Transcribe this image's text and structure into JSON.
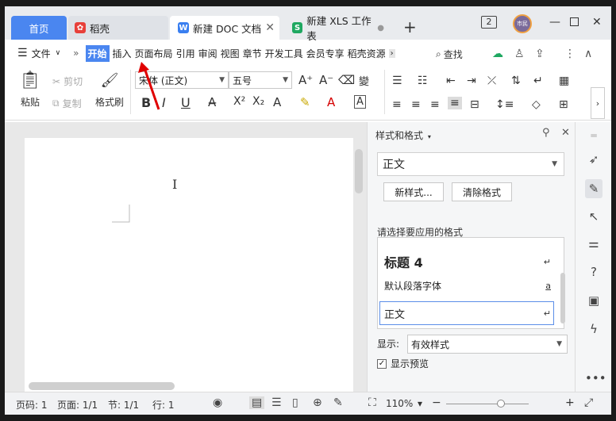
{
  "tabs": [
    {
      "label": "首页"
    },
    {
      "label": "稻壳"
    },
    {
      "label": "新建 DOC 文档"
    },
    {
      "label": "新建 XLS 工作表"
    }
  ],
  "window": {
    "badge": "2",
    "avatar": "市民"
  },
  "menu": {
    "file": "文件",
    "items": [
      "开始",
      "插入",
      "页面布局",
      "引用",
      "审阅",
      "视图",
      "章节",
      "开发工具",
      "会员专享",
      "稻壳资源"
    ],
    "search": "查找"
  },
  "ribbon": {
    "paste": "粘贴",
    "cut": "剪切",
    "copy": "复制",
    "format_painter": "格式刷",
    "font_name": "宋体 (正文)",
    "font_size": "五号",
    "bold": "B",
    "italic": "I",
    "underline": "U"
  },
  "style_pane": {
    "title": "样式和格式",
    "current_style": "正文",
    "new_style_btn": "新样式...",
    "clear_format_btn": "清除格式",
    "apply_label": "请选择要应用的格式",
    "styles": [
      {
        "name": "标题 4",
        "mark": "↵"
      },
      {
        "name": "默认段落字体",
        "mark": "a"
      },
      {
        "name": "正文",
        "mark": "↵"
      }
    ],
    "show_label": "显示:",
    "show_value": "有效样式",
    "preview_label": "显示预览"
  },
  "status": {
    "page_num": "页码: 1",
    "page": "页面: 1/1",
    "section": "节: 1/1",
    "line": "行: 1",
    "zoom": "110%"
  },
  "colors": {
    "accent": "#4a86f0",
    "doc_icon": "#3a7ff0",
    "xls_icon": "#1fa861",
    "daoke_icon": "#e8403a"
  }
}
